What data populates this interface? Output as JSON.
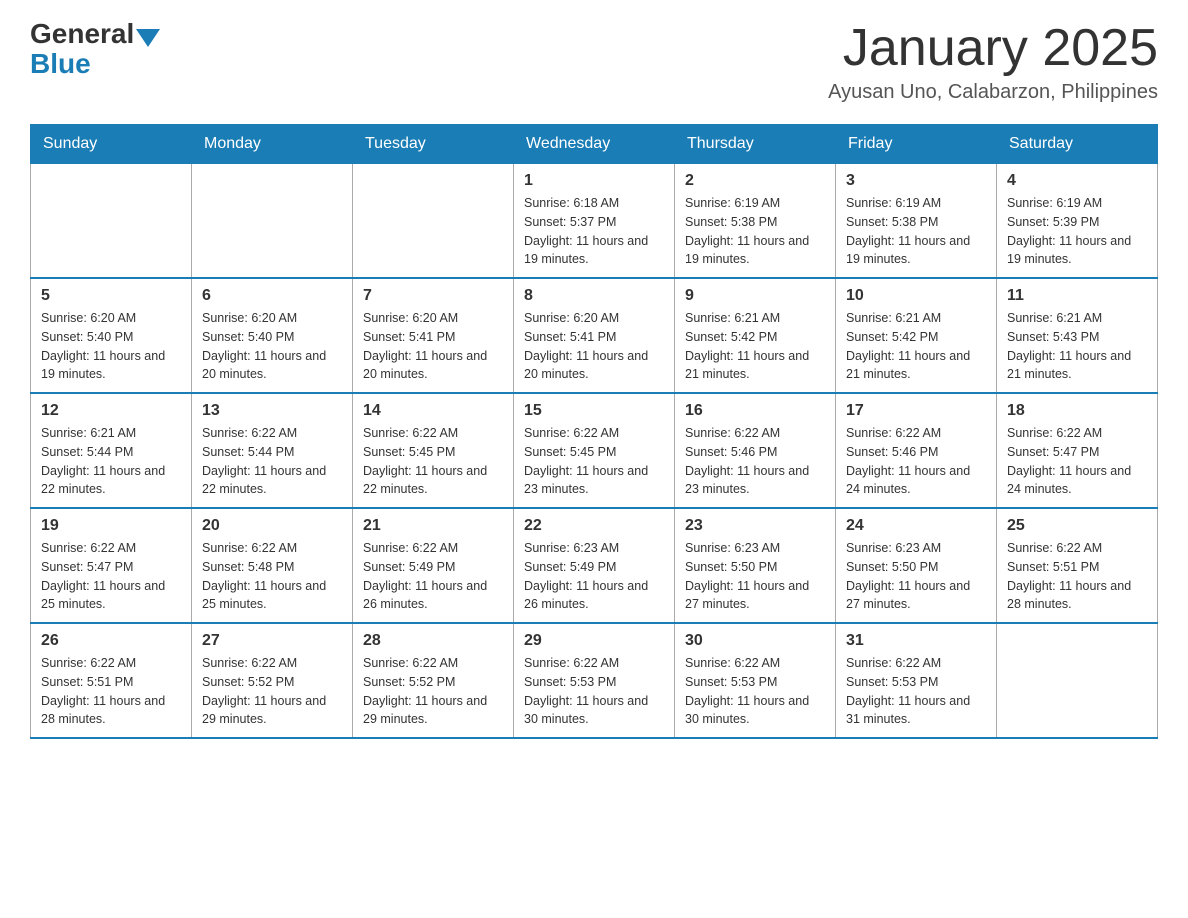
{
  "header": {
    "logo_general": "General",
    "logo_blue": "Blue",
    "title": "January 2025",
    "subtitle": "Ayusan Uno, Calabarzon, Philippines"
  },
  "days_of_week": [
    "Sunday",
    "Monday",
    "Tuesday",
    "Wednesday",
    "Thursday",
    "Friday",
    "Saturday"
  ],
  "weeks": [
    [
      {
        "day": "",
        "info": ""
      },
      {
        "day": "",
        "info": ""
      },
      {
        "day": "",
        "info": ""
      },
      {
        "day": "1",
        "info": "Sunrise: 6:18 AM\nSunset: 5:37 PM\nDaylight: 11 hours and 19 minutes."
      },
      {
        "day": "2",
        "info": "Sunrise: 6:19 AM\nSunset: 5:38 PM\nDaylight: 11 hours and 19 minutes."
      },
      {
        "day": "3",
        "info": "Sunrise: 6:19 AM\nSunset: 5:38 PM\nDaylight: 11 hours and 19 minutes."
      },
      {
        "day": "4",
        "info": "Sunrise: 6:19 AM\nSunset: 5:39 PM\nDaylight: 11 hours and 19 minutes."
      }
    ],
    [
      {
        "day": "5",
        "info": "Sunrise: 6:20 AM\nSunset: 5:40 PM\nDaylight: 11 hours and 19 minutes."
      },
      {
        "day": "6",
        "info": "Sunrise: 6:20 AM\nSunset: 5:40 PM\nDaylight: 11 hours and 20 minutes."
      },
      {
        "day": "7",
        "info": "Sunrise: 6:20 AM\nSunset: 5:41 PM\nDaylight: 11 hours and 20 minutes."
      },
      {
        "day": "8",
        "info": "Sunrise: 6:20 AM\nSunset: 5:41 PM\nDaylight: 11 hours and 20 minutes."
      },
      {
        "day": "9",
        "info": "Sunrise: 6:21 AM\nSunset: 5:42 PM\nDaylight: 11 hours and 21 minutes."
      },
      {
        "day": "10",
        "info": "Sunrise: 6:21 AM\nSunset: 5:42 PM\nDaylight: 11 hours and 21 minutes."
      },
      {
        "day": "11",
        "info": "Sunrise: 6:21 AM\nSunset: 5:43 PM\nDaylight: 11 hours and 21 minutes."
      }
    ],
    [
      {
        "day": "12",
        "info": "Sunrise: 6:21 AM\nSunset: 5:44 PM\nDaylight: 11 hours and 22 minutes."
      },
      {
        "day": "13",
        "info": "Sunrise: 6:22 AM\nSunset: 5:44 PM\nDaylight: 11 hours and 22 minutes."
      },
      {
        "day": "14",
        "info": "Sunrise: 6:22 AM\nSunset: 5:45 PM\nDaylight: 11 hours and 22 minutes."
      },
      {
        "day": "15",
        "info": "Sunrise: 6:22 AM\nSunset: 5:45 PM\nDaylight: 11 hours and 23 minutes."
      },
      {
        "day": "16",
        "info": "Sunrise: 6:22 AM\nSunset: 5:46 PM\nDaylight: 11 hours and 23 minutes."
      },
      {
        "day": "17",
        "info": "Sunrise: 6:22 AM\nSunset: 5:46 PM\nDaylight: 11 hours and 24 minutes."
      },
      {
        "day": "18",
        "info": "Sunrise: 6:22 AM\nSunset: 5:47 PM\nDaylight: 11 hours and 24 minutes."
      }
    ],
    [
      {
        "day": "19",
        "info": "Sunrise: 6:22 AM\nSunset: 5:47 PM\nDaylight: 11 hours and 25 minutes."
      },
      {
        "day": "20",
        "info": "Sunrise: 6:22 AM\nSunset: 5:48 PM\nDaylight: 11 hours and 25 minutes."
      },
      {
        "day": "21",
        "info": "Sunrise: 6:22 AM\nSunset: 5:49 PM\nDaylight: 11 hours and 26 minutes."
      },
      {
        "day": "22",
        "info": "Sunrise: 6:23 AM\nSunset: 5:49 PM\nDaylight: 11 hours and 26 minutes."
      },
      {
        "day": "23",
        "info": "Sunrise: 6:23 AM\nSunset: 5:50 PM\nDaylight: 11 hours and 27 minutes."
      },
      {
        "day": "24",
        "info": "Sunrise: 6:23 AM\nSunset: 5:50 PM\nDaylight: 11 hours and 27 minutes."
      },
      {
        "day": "25",
        "info": "Sunrise: 6:22 AM\nSunset: 5:51 PM\nDaylight: 11 hours and 28 minutes."
      }
    ],
    [
      {
        "day": "26",
        "info": "Sunrise: 6:22 AM\nSunset: 5:51 PM\nDaylight: 11 hours and 28 minutes."
      },
      {
        "day": "27",
        "info": "Sunrise: 6:22 AM\nSunset: 5:52 PM\nDaylight: 11 hours and 29 minutes."
      },
      {
        "day": "28",
        "info": "Sunrise: 6:22 AM\nSunset: 5:52 PM\nDaylight: 11 hours and 29 minutes."
      },
      {
        "day": "29",
        "info": "Sunrise: 6:22 AM\nSunset: 5:53 PM\nDaylight: 11 hours and 30 minutes."
      },
      {
        "day": "30",
        "info": "Sunrise: 6:22 AM\nSunset: 5:53 PM\nDaylight: 11 hours and 30 minutes."
      },
      {
        "day": "31",
        "info": "Sunrise: 6:22 AM\nSunset: 5:53 PM\nDaylight: 11 hours and 31 minutes."
      },
      {
        "day": "",
        "info": ""
      }
    ]
  ]
}
